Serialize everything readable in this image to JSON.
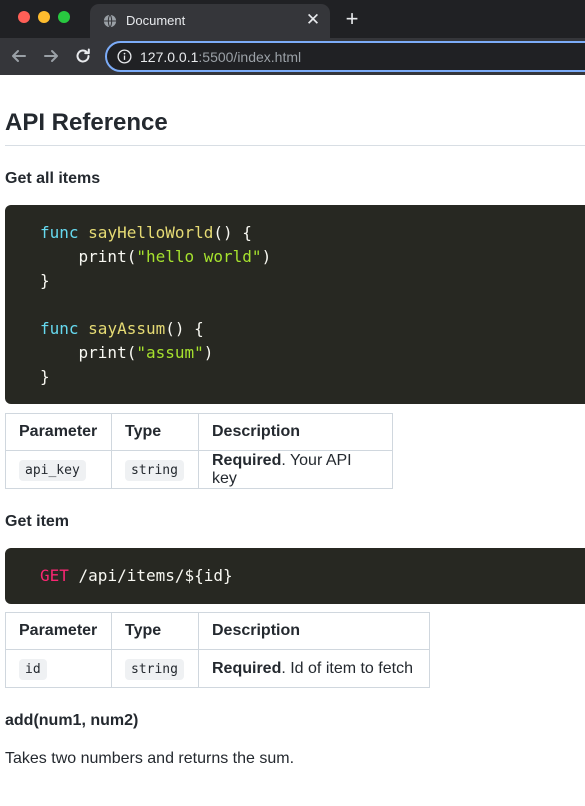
{
  "browser": {
    "tab_title": "Document",
    "close_glyph": "✕",
    "new_tab_glyph": "+",
    "url_host": "127.0.0.1",
    "url_rest": ":5500/index.html",
    "accent": "#7cacf8"
  },
  "page": {
    "title": "API Reference",
    "sections": [
      {
        "heading": "Get all items",
        "code_lines": [
          [
            {
              "t": "func ",
              "c": "kw"
            },
            {
              "t": "sayHelloWorld",
              "c": "fn"
            },
            {
              "t": "() {",
              "c": "pl"
            }
          ],
          [
            {
              "t": "    print(",
              "c": "pl"
            },
            {
              "t": "\"hello world\"",
              "c": "str"
            },
            {
              "t": ")",
              "c": "pl"
            }
          ],
          [
            {
              "t": "}",
              "c": "pl"
            }
          ],
          [],
          [
            {
              "t": "func ",
              "c": "kw"
            },
            {
              "t": "sayAssum",
              "c": "fn"
            },
            {
              "t": "() {",
              "c": "pl"
            }
          ],
          [
            {
              "t": "    print(",
              "c": "pl"
            },
            {
              "t": "\"assum\"",
              "c": "str"
            },
            {
              "t": ")",
              "c": "pl"
            }
          ],
          [
            {
              "t": "}",
              "c": "pl"
            }
          ]
        ],
        "table": {
          "headers": [
            "Parameter",
            "Type",
            "Description"
          ],
          "row": {
            "param": "api_key",
            "type": "string",
            "req": "Required",
            "desc": ". Your API key"
          }
        }
      },
      {
        "heading": "Get item",
        "code_lines": [
          [
            {
              "t": "GET",
              "c": "method"
            },
            {
              "t": " /api/items/${id}",
              "c": "pl"
            }
          ]
        ],
        "table": {
          "headers": [
            "Parameter",
            "Type",
            "Description"
          ],
          "row": {
            "param": "id",
            "type": "string",
            "req": "Required",
            "desc": ". Id of item to fetch"
          }
        }
      }
    ],
    "function_heading": "add(num1, num2)",
    "function_description": "Takes two numbers and returns the sum."
  }
}
